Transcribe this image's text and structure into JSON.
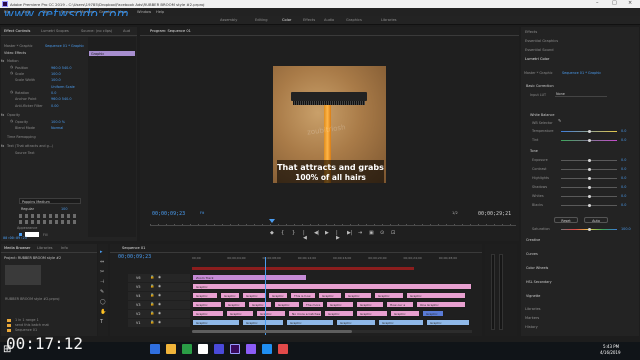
{
  "titlebar": {
    "title": "Adobe Premiere Pro CC 2019 - C:\\Users\\19785\\Dropbox\\Facebook Ads\\RUBBER BROOM style #2.prproj",
    "menu": [
      "File",
      "Edit",
      "Clip",
      "Sequence",
      "Markers",
      "Graphics",
      "View",
      "Window",
      "Help"
    ]
  },
  "watermark": "www.getwsodo.com",
  "workspaces": [
    "Assembly",
    "Editing",
    "Color",
    "Effects",
    "Audio",
    "Graphics",
    "Libraries"
  ],
  "effect_controls": {
    "tabs": [
      "Effect Controls",
      "Lumetri Scopes",
      "Source: (no clips)",
      "Aud"
    ],
    "master_label": "Master * Graphic",
    "sequence_label": "Sequence 01 * Graphic",
    "header": "Video Effects",
    "rows": [
      {
        "name": "Motion",
        "value": ""
      },
      {
        "name": "Position",
        "value": "960.0   540.0"
      },
      {
        "name": "Scale",
        "value": "100.0"
      },
      {
        "name": "Scale Width",
        "value": "100.0"
      },
      {
        "name": "",
        "value": "Uniform Scale"
      },
      {
        "name": "Rotation",
        "value": "0.0"
      },
      {
        "name": "Anchor Point",
        "value": "960.0   540.0"
      },
      {
        "name": "Anti-flicker Filter",
        "value": "0.00"
      },
      {
        "name": "Opacity",
        "value": ""
      },
      {
        "name": "Opacity",
        "value": "100.0 %"
      },
      {
        "name": "Blend Mode",
        "value": "Normal"
      },
      {
        "name": "Time Remapping",
        "value": ""
      },
      {
        "name": "Text (That attracts and g...)",
        "value": ""
      },
      {
        "name": "Source Text",
        "value": ""
      }
    ],
    "font_name": "Poppins Medium",
    "font_style": "Regular",
    "font_size": "100",
    "appearance_label": "Appearance",
    "fill_label": "Fill",
    "timecode": "00:00:09:23",
    "graphic_clip": "Graphic"
  },
  "program_monitor": {
    "title": "Program: Sequence 01",
    "caption_line1": "That attracts and grabs",
    "caption_line2": "100% of all hairs",
    "watermark_text": "zoubitriosh",
    "current_time": "00;00;09;23",
    "zoom": "Fit",
    "quality": "1/2",
    "duration": "00;00;29;21"
  },
  "media_browser": {
    "tabs": [
      "Media Browser",
      "Libraries",
      "Info"
    ],
    "project": "Project: RUBBER BROOM style #2",
    "file": "RUBBER BROOM style #2.prproj",
    "items": [
      "1 in 1 range 1",
      "send this batch mat",
      "Sequence 01"
    ]
  },
  "timeline": {
    "tab": "Sequence 01",
    "timecode": "00;00;09;23",
    "ruler": [
      "00;00",
      "00;00;04;00",
      "00;00;08;00",
      "00;00;12;00",
      "00;00;16;00",
      "00;00;20;00",
      "00;00;24;00",
      "00;00;28;00"
    ],
    "tracks": [
      "V6",
      "V5",
      "V4",
      "V3",
      "V2",
      "V1"
    ],
    "clip_labels": [
      "Zoom Track",
      "Graphic",
      "Graphic",
      "Graphic",
      "Graphic",
      "Graphic",
      "This is how",
      "Graphic",
      "Graphic",
      "Graphic",
      "Graphic",
      "Graphic",
      "Graphic",
      "Graphic",
      "Graphic",
      "The more",
      "Graphic",
      "Graphic",
      "How our a",
      "One Graphic",
      "Graphic",
      "Graphic",
      "Graphic",
      "No more scratches annoying",
      "Graphic",
      "Graphic",
      "Graphic",
      "Graphic",
      "Graphic",
      "Graphic",
      "Graphic",
      "Graphic",
      "Graphic",
      "Graphic",
      "Graphic",
      "Graphic",
      "ZoomOut.mp4",
      "Rubber Broom",
      "Graphic",
      "Rubber Broom",
      "Get Broom & Rubber Broom"
    ]
  },
  "lumetri": {
    "tabs": [
      "Effects",
      "Essential Graphics",
      "Essential Sound",
      "Lumetri Color"
    ],
    "master": "Master * Graphic",
    "seq": "Sequence 01 * Graphic",
    "basic_correction": "Basic Correction",
    "input_lut": "Input LUT",
    "input_lut_value": "None",
    "white_balance": "White Balance",
    "wb_selector": "WB Selector",
    "temperature": "Temperature",
    "tint": "Tint",
    "tone": "Tone",
    "tone_rows": [
      "Exposure",
      "Contrast",
      "Highlights",
      "Shadows",
      "Whites",
      "Blacks"
    ],
    "tone_values": [
      "0.0",
      "0.0",
      "0.0",
      "0.0",
      "0.0",
      "0.0"
    ],
    "temp_value": "0.0",
    "tint_value": "0.0",
    "reset": "Reset",
    "auto": "Auto",
    "saturation": "Saturation",
    "saturation_value": "100.0",
    "sections": [
      "Creative",
      "Curves",
      "Color Wheels",
      "HSL Secondary",
      "Vignette"
    ],
    "bottom": [
      "Libraries",
      "Markers",
      "History"
    ]
  },
  "taskbar": {
    "elapsed": "00:17:12",
    "time": "5:43 PM",
    "date": "4/16/2019"
  }
}
